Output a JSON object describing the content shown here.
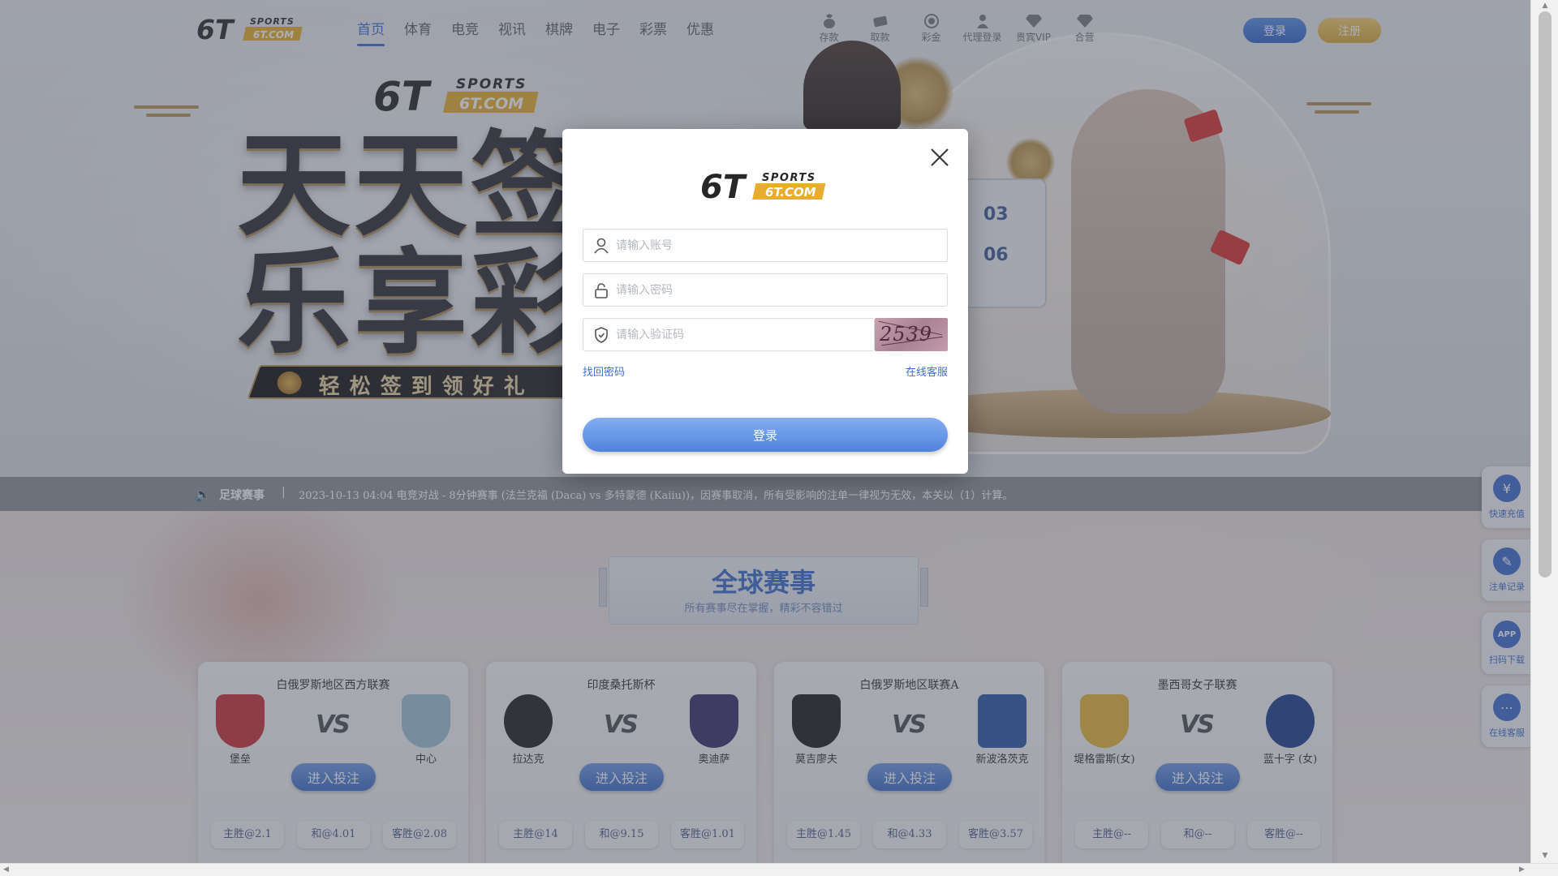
{
  "brand": {
    "mark": "6T",
    "top_text": "SPORTS",
    "bottom_text": "6T.COM"
  },
  "nav": [
    {
      "label": "首页",
      "active": true
    },
    {
      "label": "体育"
    },
    {
      "label": "电竞"
    },
    {
      "label": "视讯"
    },
    {
      "label": "棋牌"
    },
    {
      "label": "电子"
    },
    {
      "label": "彩票"
    },
    {
      "label": "优惠"
    }
  ],
  "quick_links": [
    {
      "label": "存款",
      "icon": "deposit-icon"
    },
    {
      "label": "取款",
      "icon": "withdraw-icon"
    },
    {
      "label": "彩金",
      "icon": "bonus-icon"
    },
    {
      "label": "代理登录",
      "icon": "agent-icon"
    },
    {
      "label": "贵宾VIP",
      "icon": "vip-diamond-icon"
    },
    {
      "label": "合营",
      "icon": "partnership-icon"
    }
  ],
  "header_buttons": {
    "login": "登录",
    "register": "注册"
  },
  "hero": {
    "title_line1": "天天签到",
    "title_line2": "乐享彩金",
    "ribbon": "轻松签到领好礼",
    "calendar_numbers": [
      "03",
      "06"
    ]
  },
  "ticker": {
    "label": "足球赛事",
    "separator": "|",
    "text": "2023-10-13 04:04 电竞对战 - 8分钟赛事 (法兰克福 (Daca) vs 多特蒙德 (Kaiiu))，因赛事取消，所有受影响的注单一律视为无效，本关以（1）计算。"
  },
  "section": {
    "title": "全球赛事",
    "subtitle": "所有赛事尽在掌握，精彩不容错过"
  },
  "matches": [
    {
      "league": "白俄罗斯地区西方联赛",
      "home": "堡垒",
      "away": "中心",
      "home_color": "#c8303a",
      "away_color": "#9fc4d8",
      "bet": "进入投注",
      "odds": [
        "主胜@2.1",
        "和@4.01",
        "客胜@2.08"
      ]
    },
    {
      "league": "印度桑托斯杯",
      "home": "拉达克",
      "away": "奥迪萨",
      "home_color": "#222222",
      "away_color": "#3b2f6a",
      "bet": "进入投注",
      "odds": [
        "主胜@14",
        "和@9.15",
        "客胜@1.01"
      ]
    },
    {
      "league": "白俄罗斯地区联赛A",
      "home": "莫吉廖夫",
      "away": "新波洛茨克",
      "home_color": "#1e1e1e",
      "away_color": "#2a5aa8",
      "bet": "进入投注",
      "odds": [
        "主胜@1.45",
        "和@4.33",
        "客胜@3.57"
      ]
    },
    {
      "league": "墨西哥女子联赛",
      "home": "堤格雷斯(女)",
      "away": "蓝十字 (女)",
      "home_color": "#e3b63a",
      "away_color": "#1f3f8f",
      "bet": "进入投注",
      "odds": [
        "主胜@--",
        "和@--",
        "客胜@--"
      ]
    }
  ],
  "vs_label": "VS",
  "floating": [
    {
      "label": "快速充值",
      "icon": "recharge-icon"
    },
    {
      "label": "注单记录",
      "icon": "bet-record-icon"
    },
    {
      "label": "扫码下载",
      "icon": "app-download-icon",
      "icon_text": "APP"
    },
    {
      "label": "在线客服",
      "icon": "chat-icon"
    }
  ],
  "modal": {
    "account_placeholder": "请输入账号",
    "password_placeholder": "请输入密码",
    "captcha_placeholder": "请输入验证码",
    "captcha_text": "2539",
    "forgot": "找回密码",
    "support": "在线客服",
    "submit": "登录"
  },
  "colors": {
    "accent": "#3f6fd1",
    "gold": "#d9a737",
    "ticker_bg": "#8c9099"
  }
}
